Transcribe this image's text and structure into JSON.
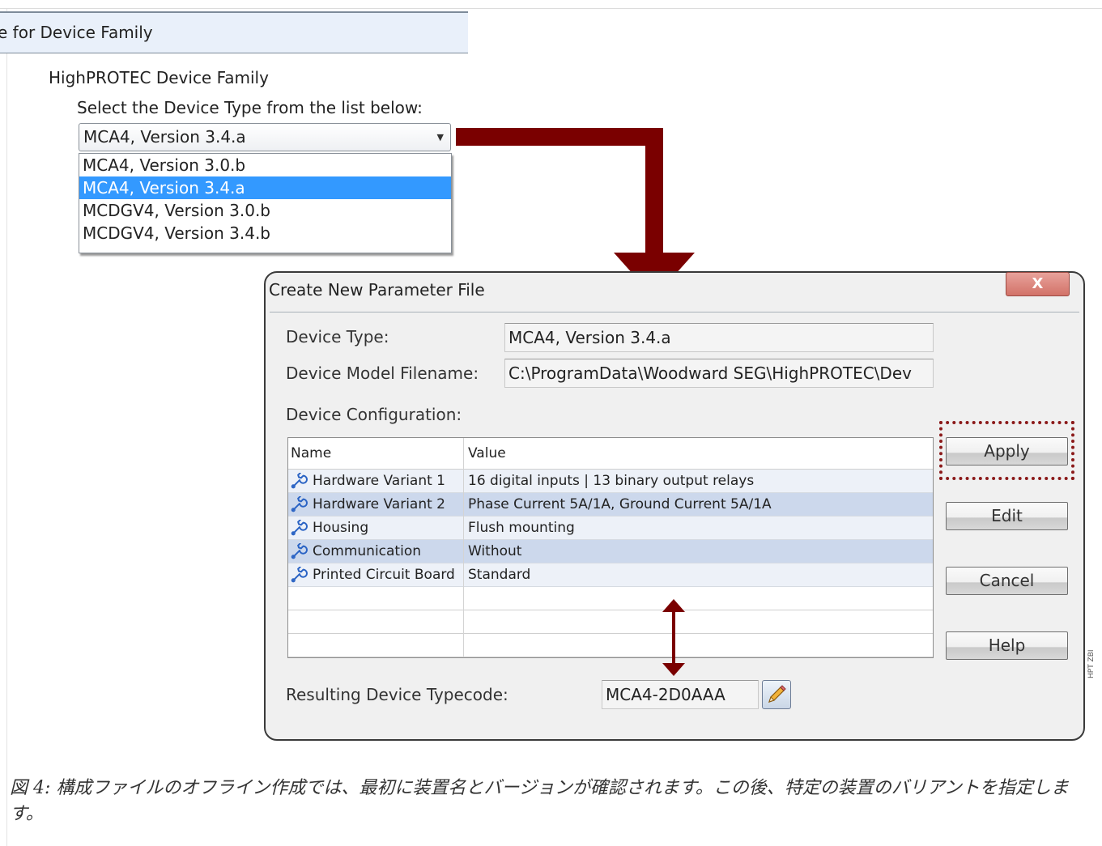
{
  "page": {
    "family_header": "e for Device Family",
    "family_name": "HighPROTEC Device Family",
    "select_prompt": "Select the Device Type from the list below:",
    "combo_value": "MCA4, Version 3.4.a",
    "dropdown_items": [
      "MCA4, Version 3.0.b",
      "MCA4, Version 3.4.a",
      "MCDGV4, Version 3.0.b",
      "MCDGV4, Version 3.4.b"
    ],
    "dropdown_selected": "MCA4, Version 3.4.a"
  },
  "dialog": {
    "title": "Create New Parameter File",
    "close_label": "X",
    "device_type_label": "Device Type:",
    "device_type_value": "MCA4, Version 3.4.a",
    "model_filename_label": "Device Model Filename:",
    "model_filename_value": "C:\\ProgramData\\Woodward SEG\\HighPROTEC\\Dev",
    "config_label": "Device Configuration:",
    "table": {
      "headers": [
        "Name",
        "Value"
      ],
      "rows": [
        {
          "name": "Hardware Variant 1",
          "value": "16 digital inputs | 13 binary output relays",
          "icon": "wrench-icon"
        },
        {
          "name": "Hardware Variant 2",
          "value": "Phase Current 5A/1A, Ground Current 5A/1A",
          "icon": "wrench-icon"
        },
        {
          "name": "Housing",
          "value": "Flush mounting",
          "icon": "wrench-icon"
        },
        {
          "name": "Communication",
          "value": "Without",
          "icon": "wrench-icon"
        },
        {
          "name": "Printed Circuit Board",
          "value": "Standard",
          "icon": "wrench-icon"
        }
      ]
    },
    "buttons": {
      "apply": "Apply",
      "edit": "Edit",
      "cancel": "Cancel",
      "help": "Help"
    },
    "typecode_label": "Resulting Device Typecode:",
    "typecode_value": "MCA4-2D0AAA"
  },
  "side_tag": "HPT ZBI",
  "caption": "図 4: 構成ファイルのオフライン作成では、最初に装置名とバージョンが確認されます。この後、特定の装置のバリアントを指定します。",
  "colors": {
    "arrow": "#7a0000",
    "selection": "#3399ff",
    "row_alt": "#ccd8ec",
    "row": "#edf1f8",
    "highlight_border": "#8b1a1a"
  }
}
